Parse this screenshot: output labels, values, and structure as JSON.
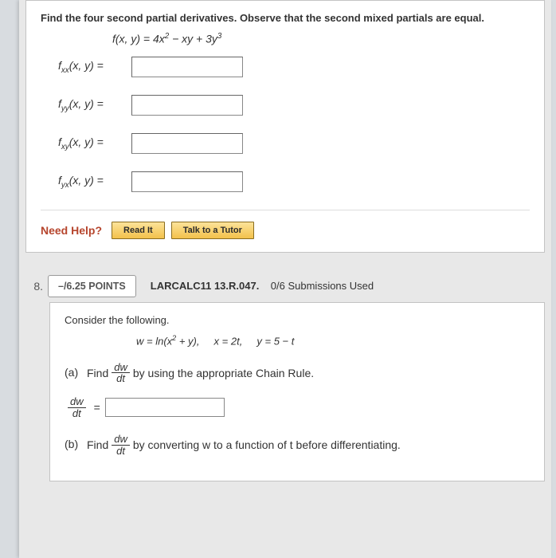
{
  "q7": {
    "prompt": "Find the four second partial derivatives. Observe that the second mixed partials are equal.",
    "func_lhs": "f(x, y) = ",
    "func_rhs_a": "4x",
    "func_rhs_b": " − xy + 3y",
    "labels": {
      "fxx_pre": "f",
      "fxx_sub": "xx",
      "fxx_post": "(x, y)  =",
      "fyy_pre": "f",
      "fyy_sub": "yy",
      "fyy_post": "(x, y)  =",
      "fxy_pre": "f",
      "fxy_sub": "xy",
      "fxy_post": "(x, y)  =",
      "fyx_pre": "f",
      "fyx_sub": "yx",
      "fyx_post": "(x, y)  ="
    },
    "help_label": "Need Help?",
    "read_it": "Read It",
    "talk_tutor": "Talk to a Tutor"
  },
  "q8": {
    "num": "8.",
    "points": "–/6.25 POINTS",
    "ref_bold": "LARCALC11 13.R.047.",
    "ref_rest": "0/6 Submissions Used",
    "consider": "Consider the following.",
    "eqs_w": "w = ln(x",
    "eqs_w2": " + y),",
    "eqs_x": "x = 2t,",
    "eqs_y": "y = 5 − t",
    "a_label": "(a)",
    "a_find": "Find",
    "a_after": "by using the appropriate Chain Rule.",
    "dw": "dw",
    "dt": "dt",
    "equals": "=",
    "b_label": "(b)",
    "b_find": "Find",
    "b_after": "by converting w to a function of t before differentiating."
  }
}
